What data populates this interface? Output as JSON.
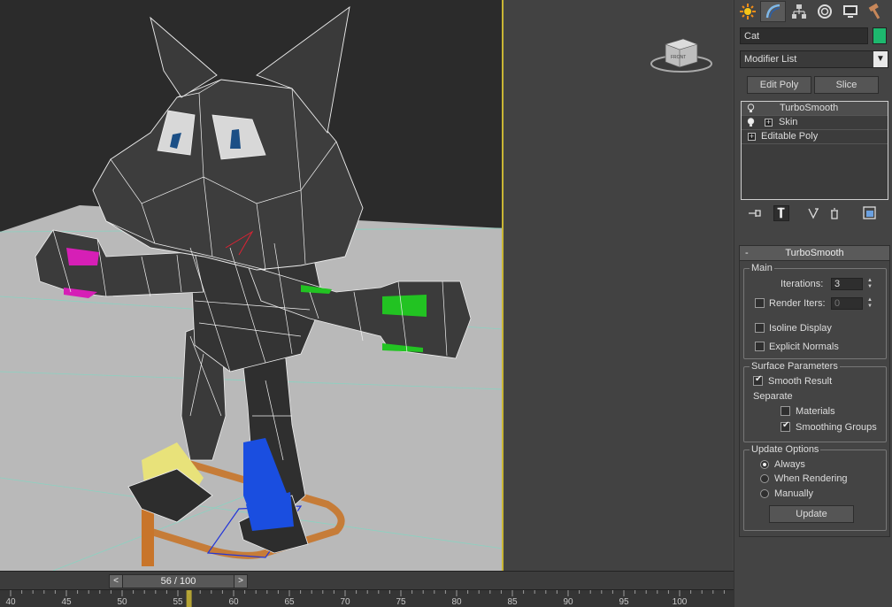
{
  "object_name": "Cat",
  "object_color": "#1db86e",
  "modifier_list_label": "Modifier List",
  "buttons": {
    "edit_poly": "Edit Poly",
    "slice": "Slice"
  },
  "stack": [
    {
      "label": "TurboSmooth",
      "selected": true
    },
    {
      "label": "Skin",
      "expandable": true
    },
    {
      "label": "Editable Poly",
      "expandable": true
    }
  ],
  "tabs": [
    "create-icon",
    "modify-icon",
    "hierarchy-icon",
    "motion-icon",
    "display-icon",
    "utilities-icon"
  ],
  "rollout": {
    "collapse": "-",
    "title": "TurboSmooth",
    "main": {
      "title": "Main",
      "iterations_label": "Iterations:",
      "iterations_value": "3",
      "render_iters_label": "Render Iters:",
      "render_iters_value": "0",
      "render_iters_checked": false,
      "isoline_label": "Isoline Display",
      "isoline_checked": false,
      "explicit_normals_label": "Explicit Normals",
      "explicit_normals_checked": false
    },
    "surface": {
      "title": "Surface Parameters",
      "smooth_result_label": "Smooth Result",
      "smooth_result_checked": true,
      "separate_label": "Separate",
      "materials_label": "Materials",
      "materials_checked": false,
      "smoothing_groups_label": "Smoothing Groups",
      "smoothing_groups_checked": true
    },
    "update": {
      "title": "Update Options",
      "always_label": "Always",
      "when_rendering_label": "When Rendering",
      "manually_label": "Manually",
      "selected": "Always",
      "update_button": "Update"
    }
  },
  "viewcube": {
    "face": "FRONT"
  },
  "timeline": {
    "prev": "<",
    "next": ">",
    "current_frame": 56,
    "total_frames": 100,
    "current_label": "56 / 100",
    "tick_labels": [
      "40",
      "45",
      "50",
      "55",
      "60",
      "65",
      "70",
      "75",
      "80",
      "85",
      "90",
      "95",
      "100"
    ]
  }
}
